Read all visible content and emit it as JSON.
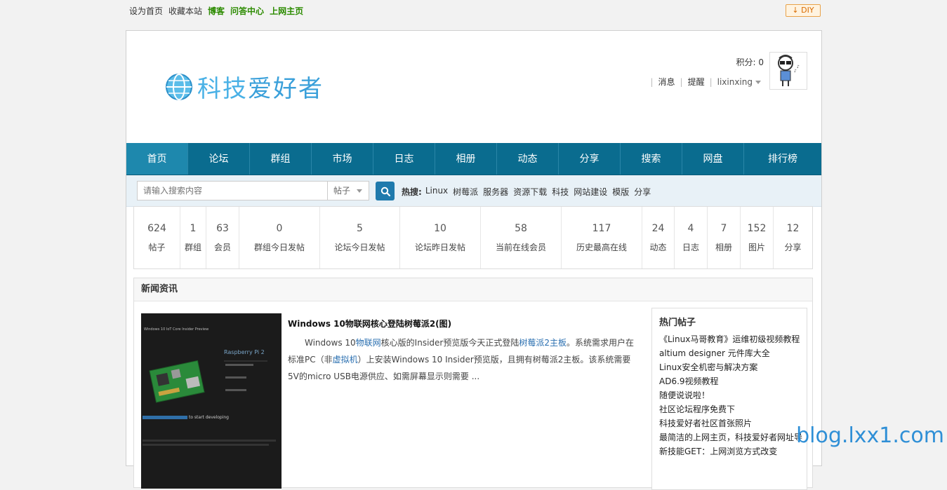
{
  "top": {
    "links": [
      "设为首页",
      "收藏本站"
    ],
    "green_links": [
      "博客",
      "问答中心",
      "上网主页"
    ],
    "diy_label": "DIY"
  },
  "header": {
    "logo_a": "科技",
    "logo_b": "爱好者",
    "score": "积分: 0",
    "messages": "消息",
    "reminders": "提醒",
    "username": "lixinxing"
  },
  "nav": [
    "首页",
    "论坛",
    "群组",
    "市场",
    "日志",
    "相册",
    "动态",
    "分享",
    "搜索",
    "网盘",
    "排行榜"
  ],
  "search": {
    "placeholder": "请输入搜索内容",
    "select_value": "帖子",
    "hot_label": "热搜:",
    "hot_terms": [
      "Linux",
      "树莓派",
      "服务器",
      "资源下载",
      "科技",
      "网站建设",
      "模版",
      "分享"
    ]
  },
  "stats": [
    {
      "num": "624",
      "label": "帖子"
    },
    {
      "num": "1",
      "label": "群组"
    },
    {
      "num": "63",
      "label": "会员"
    },
    {
      "num": "0",
      "label": "群组今日发帖"
    },
    {
      "num": "5",
      "label": "论坛今日发帖"
    },
    {
      "num": "10",
      "label": "论坛昨日发帖"
    },
    {
      "num": "58",
      "label": "当前在线会员"
    },
    {
      "num": "117",
      "label": "历史最高在线"
    },
    {
      "num": "24",
      "label": "动态"
    },
    {
      "num": "4",
      "label": "日志"
    },
    {
      "num": "7",
      "label": "相册"
    },
    {
      "num": "152",
      "label": "图片"
    },
    {
      "num": "12",
      "label": "分享"
    }
  ],
  "news": {
    "heading": "新闻资讯",
    "title": "Windows 10物联网核心登陆树莓派2(图)",
    "body": {
      "p1": "Windows 10",
      "link1": "物联网",
      "p2": "核心版的Insider预览版今天正式登陆",
      "link2": "树莓派2主板",
      "p3": "。系统需求用户在标准PC（非",
      "link3": "虚拟机",
      "p4": "）上安装Windows 10 Insider预览版，且拥有树莓派2主板。该系统需要5V的micro USB电源供应、如需屏幕显示则需要 ..."
    },
    "image_text": {
      "caption": "Windows 10 IoT Core Insider Preview",
      "device": "Raspberry Pi 2",
      "cta": "to start developing"
    }
  },
  "hot_posts": {
    "title": "热门帖子",
    "items": [
      "《Linux马哥教育》运维初级视频教程",
      "altium designer 元件库大全",
      "Linux安全机密与解决方案",
      "AD6.9视频教程",
      "随便说说啦！",
      "社区论坛程序免费下",
      "科技爱好者社区首张照片",
      "最简洁的上网主页，科技爱好者网址导",
      "新技能GET：上网浏览方式改变"
    ]
  },
  "watermark": "blog.lxx1.com",
  "colors": {
    "nav": "#0a6c8f",
    "nav_active": "#1e88ad",
    "logo": "#4ab1e6",
    "green": "#2c8b00"
  }
}
